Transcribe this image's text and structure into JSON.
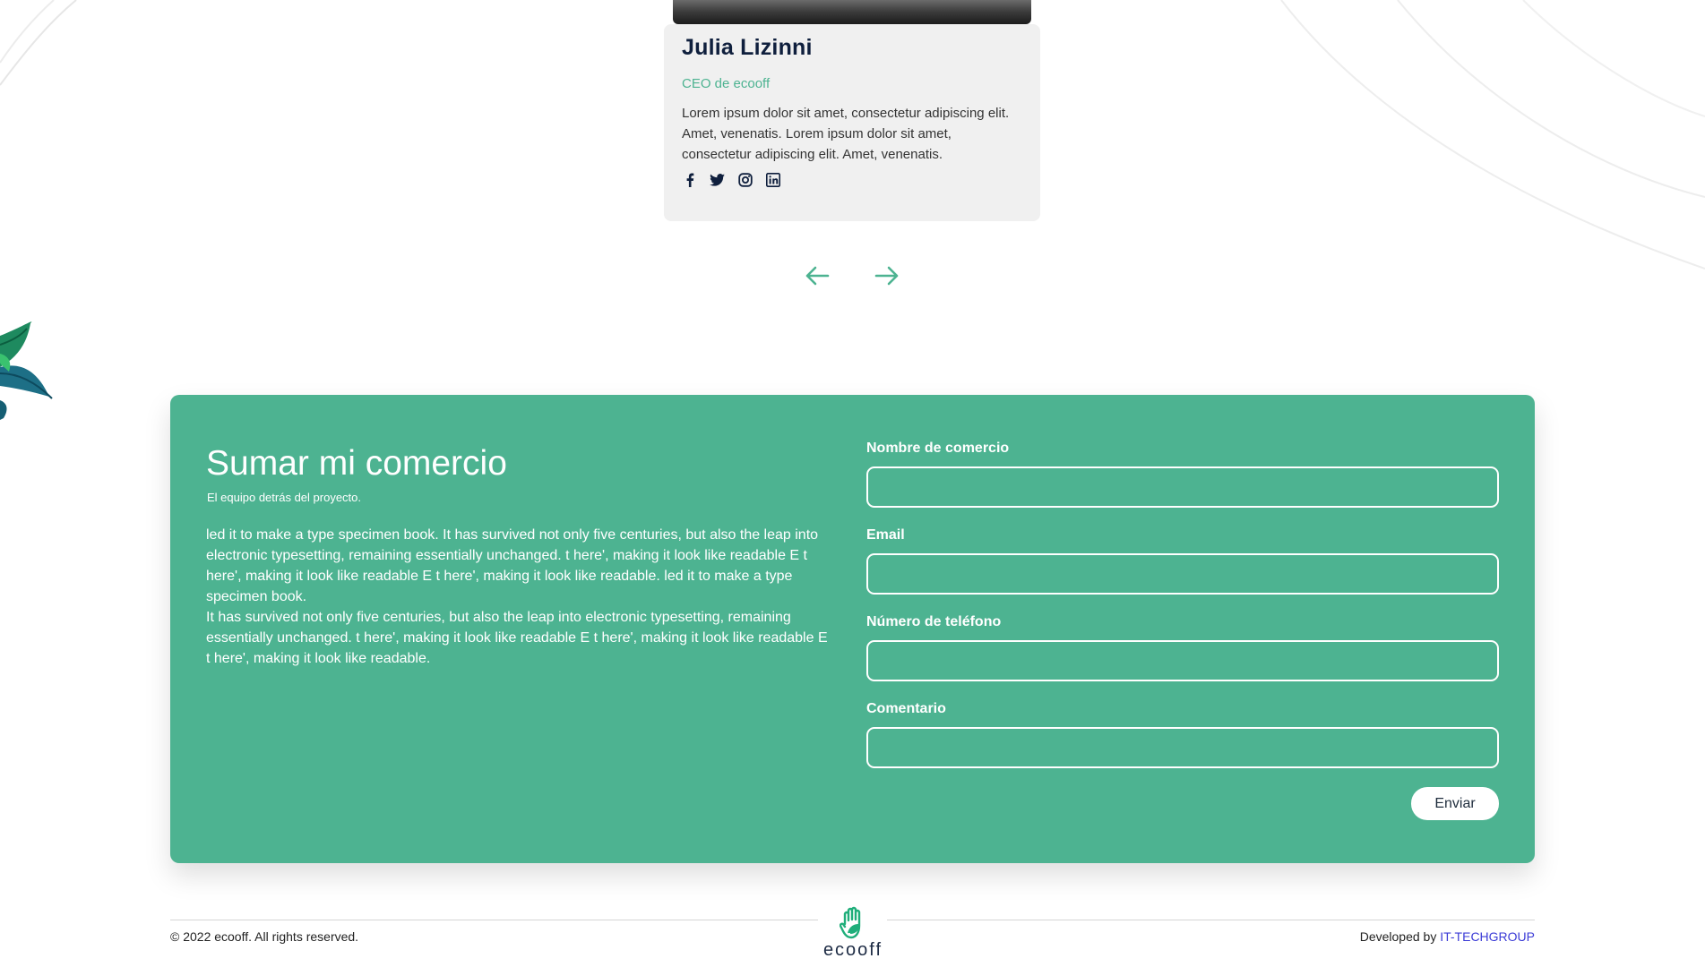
{
  "team_card": {
    "name": "Julia Lizinni",
    "role": "CEO de ecooff",
    "bio": "Lorem ipsum dolor sit amet, consectetur adipiscing elit. Amet, venenatis. Lorem ipsum dolor sit amet, consectetur adipiscing elit. Amet, venenatis.",
    "socials": [
      "facebook-icon",
      "twitter-icon",
      "instagram-icon",
      "linkedin-icon"
    ]
  },
  "carousel": {
    "prev_icon": "arrow-left-icon",
    "next_icon": "arrow-right-icon"
  },
  "signup_form": {
    "title": "Sumar mi comercio",
    "subtitle": "El equipo detrás del proyecto.",
    "description_1": "led it to make a type specimen book. It has survived not only five centuries, but also the leap into electronic typesetting, remaining essentially unchanged. t here', making it look like readable E t here', making it look like readable E t here', making it look like readable. led it to make a type specimen book.",
    "description_2": "It has survived not only five centuries, but also the leap into electronic typesetting, remaining essentially unchanged. t here', making it look like readable E t here', making it look like readable E t here', making it look like readable.",
    "fields": [
      {
        "label": "Nombre de comercio",
        "value": ""
      },
      {
        "label": "Email",
        "value": ""
      },
      {
        "label": "Número de teléfono",
        "value": ""
      },
      {
        "label": "Comentario",
        "value": ""
      }
    ],
    "submit_label": "Enviar"
  },
  "footer": {
    "copyright": "© 2022 ecooff. All rights reserved.",
    "logo_text": "ecooff",
    "developed_by_label": "Developed by",
    "developer_name": "IT-TECHGROUP"
  },
  "colors": {
    "primary_green": "#4db391",
    "dark_navy": "#0f1f3d",
    "card_bg": "#f0f0f0",
    "link_blue": "#3b3bd6"
  }
}
